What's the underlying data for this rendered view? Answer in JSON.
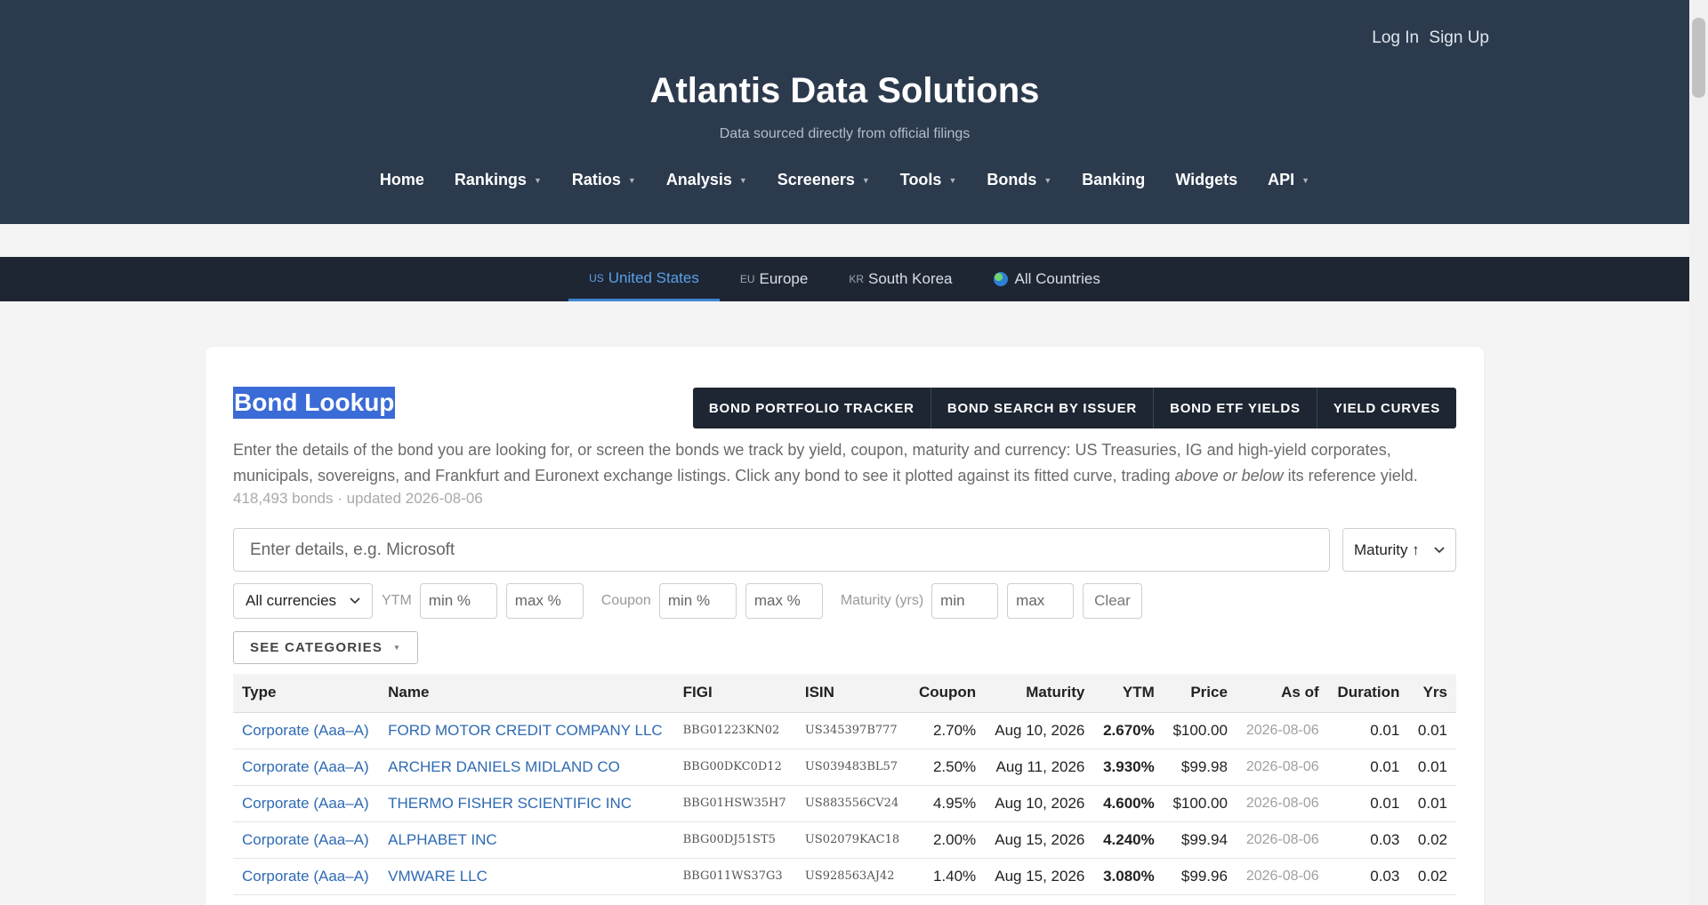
{
  "header": {
    "auth": [
      "Log In",
      "Sign Up"
    ],
    "title": "Atlantis Data Solutions",
    "subtitle": "Data sourced directly from official filings",
    "nav": [
      {
        "label": "Home",
        "dropdown": false
      },
      {
        "label": "Rankings",
        "dropdown": true
      },
      {
        "label": "Ratios",
        "dropdown": true
      },
      {
        "label": "Analysis",
        "dropdown": true
      },
      {
        "label": "Screeners",
        "dropdown": true
      },
      {
        "label": "Tools",
        "dropdown": true
      },
      {
        "label": "Bonds",
        "dropdown": true
      },
      {
        "label": "Banking",
        "dropdown": false
      },
      {
        "label": "Widgets",
        "dropdown": false
      },
      {
        "label": "API",
        "dropdown": true
      }
    ]
  },
  "countries": [
    {
      "code": "US",
      "label": "United States",
      "active": true
    },
    {
      "code": "EU",
      "label": "Europe",
      "active": false
    },
    {
      "code": "KR",
      "label": "South Korea",
      "active": false
    },
    {
      "code": "",
      "label": "All Countries",
      "active": false,
      "icon": "globe-icon"
    }
  ],
  "card": {
    "title": "Bond Lookup",
    "buttons": [
      "BOND PORTFOLIO TRACKER",
      "BOND SEARCH BY ISSUER",
      "BOND ETF YIELDS",
      "YIELD CURVES"
    ],
    "desc_part1": "Enter the details of the bond you are looking for, or screen the bonds we track by yield, coupon, maturity and currency: US Treasuries, IG and high-yield corporates, municipals, sovereigns, and Frankfurt and Euronext exchange listings. Click any bond to see it plotted against its fitted curve, trading ",
    "desc_em": "above or below",
    "desc_part2": " its reference yield.",
    "meta": "418,493 bonds · updated 2026-08-06",
    "search_placeholder": "Enter details, e.g. Microsoft",
    "sort_value": "Maturity ↑",
    "currency_value": "All currencies",
    "ytm_label": "YTM",
    "coupon_label": "Coupon",
    "maturity_label": "Maturity (yrs)",
    "min_pct": "min %",
    "max_pct": "max %",
    "min": "min",
    "max": "max",
    "clear": "Clear",
    "categories": "SEE CATEGORIES"
  },
  "table": {
    "headers": [
      "Type",
      "Name",
      "FIGI",
      "ISIN",
      "Coupon",
      "Maturity",
      "YTM",
      "Price",
      "As of",
      "Duration",
      "Yrs"
    ],
    "rows": [
      [
        "Corporate (Aaa–A)",
        "FORD MOTOR CREDIT COMPANY LLC",
        "BBG01223KN02",
        "US345397B777",
        "2.70%",
        "Aug 10, 2026",
        "2.670%",
        "$100.00",
        "2026-08-06",
        "0.01",
        "0.01"
      ],
      [
        "Corporate (Aaa–A)",
        "ARCHER DANIELS MIDLAND CO",
        "BBG00DKC0D12",
        "US039483BL57",
        "2.50%",
        "Aug 11, 2026",
        "3.930%",
        "$99.98",
        "2026-08-06",
        "0.01",
        "0.01"
      ],
      [
        "Corporate (Aaa–A)",
        "THERMO FISHER SCIENTIFIC INC",
        "BBG01HSW35H7",
        "US883556CV24",
        "4.95%",
        "Aug 10, 2026",
        "4.600%",
        "$100.00",
        "2026-08-06",
        "0.01",
        "0.01"
      ],
      [
        "Corporate (Aaa–A)",
        "ALPHABET INC",
        "BBG00DJ51ST5",
        "US02079KAC18",
        "2.00%",
        "Aug 15, 2026",
        "4.240%",
        "$99.94",
        "2026-08-06",
        "0.03",
        "0.02"
      ],
      [
        "Corporate (Aaa–A)",
        "VMWARE LLC",
        "BBG011WS37G3",
        "US928563AJ42",
        "1.40%",
        "Aug 15, 2026",
        "3.080%",
        "$99.96",
        "2026-08-06",
        "0.03",
        "0.02"
      ]
    ]
  }
}
